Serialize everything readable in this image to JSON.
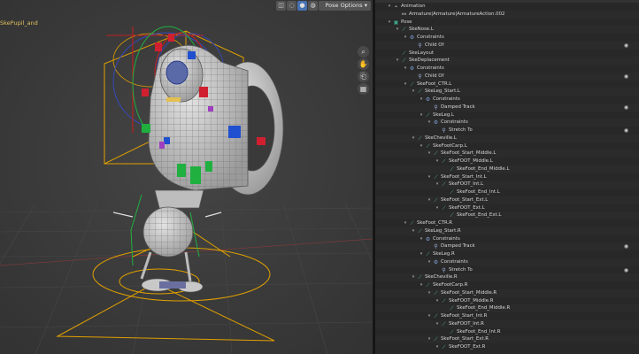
{
  "viewport": {
    "object_label": "SkePupil_and",
    "pose_options_label": "Pose Options",
    "pose_options_arrow": "▾",
    "header_buttons": [
      {
        "name": "xray-toggle",
        "glyph": "◫",
        "active": false
      },
      {
        "name": "shading-wireframe",
        "glyph": "◌",
        "active": false
      },
      {
        "name": "shading-solid",
        "glyph": "●",
        "active": true
      },
      {
        "name": "shading-material",
        "glyph": "◍",
        "active": false
      },
      {
        "name": "shading-rendered",
        "glyph": "◎",
        "active": false
      }
    ],
    "nav_buttons": [
      {
        "name": "zoom-icon",
        "glyph": "⌕"
      },
      {
        "name": "hand-pan-icon",
        "glyph": "✋"
      },
      {
        "name": "camera-view-icon",
        "glyph": "⎗"
      },
      {
        "name": "perspective-grid-icon",
        "glyph": "▦"
      }
    ]
  },
  "outliner": {
    "rows": [
      {
        "label": "Animation",
        "icon": "anim",
        "glyph": "⌁",
        "depth": 1,
        "arrow": "▾"
      },
      {
        "label": "Armature|Armature|ArmatureAction.002",
        "icon": "act",
        "glyph": "⚯",
        "depth": 2,
        "arrow": ""
      },
      {
        "label": "Pose",
        "icon": "pose",
        "glyph": "▣",
        "depth": 1,
        "arrow": "▾"
      },
      {
        "label": "SkeNose.L",
        "icon": "bone",
        "glyph": "⟋",
        "depth": 2,
        "arrow": "▾"
      },
      {
        "label": "Constraints",
        "icon": "constraints",
        "glyph": "⚙",
        "depth": 3,
        "arrow": "▾"
      },
      {
        "label": "Child Of",
        "icon": "cons",
        "glyph": "⚲",
        "depth": 4,
        "arrow": "",
        "eye": "◉"
      },
      {
        "label": "SkeLayout",
        "icon": "bone",
        "glyph": "⟋",
        "depth": 2,
        "arrow": ""
      },
      {
        "label": "SkeDeplacement",
        "icon": "bone",
        "glyph": "⟋",
        "depth": 2,
        "arrow": "▾"
      },
      {
        "label": "Constraints",
        "icon": "constraints",
        "glyph": "⚙",
        "depth": 3,
        "arrow": "▾"
      },
      {
        "label": "Child Of",
        "icon": "cons",
        "glyph": "⚲",
        "depth": 4,
        "arrow": "",
        "eye": "◉"
      },
      {
        "label": "SkeFoot_CTR.L",
        "icon": "bone",
        "glyph": "⟋",
        "depth": 3,
        "arrow": "▾"
      },
      {
        "label": "SkeLeg_Start.L",
        "icon": "bone",
        "glyph": "⟋",
        "depth": 4,
        "arrow": "▾"
      },
      {
        "label": "Constraints",
        "icon": "constraints",
        "glyph": "⚙",
        "depth": 5,
        "arrow": "▾"
      },
      {
        "label": "Damped Track",
        "icon": "cons",
        "glyph": "⚲",
        "depth": 6,
        "arrow": "",
        "eye": "◉"
      },
      {
        "label": "SkeLeg.L",
        "icon": "bone",
        "glyph": "⟋",
        "depth": 5,
        "arrow": "▾"
      },
      {
        "label": "Constraints",
        "icon": "constraints",
        "glyph": "⚙",
        "depth": 6,
        "arrow": "▾"
      },
      {
        "label": "Stretch To",
        "icon": "cons",
        "glyph": "⚲",
        "depth": 7,
        "arrow": "",
        "eye": "◉"
      },
      {
        "label": "SkeCheville.L",
        "icon": "bone",
        "glyph": "⟋",
        "depth": 4,
        "arrow": "▾"
      },
      {
        "label": "SkeFootCarp.L",
        "icon": "bone",
        "glyph": "⟋",
        "depth": 5,
        "arrow": "▾"
      },
      {
        "label": "SkeFoot_Start_Middle.L",
        "icon": "bone",
        "glyph": "⟋",
        "depth": 6,
        "arrow": "▾"
      },
      {
        "label": "SkeFOOT_Middle.L",
        "icon": "bone",
        "glyph": "⟋",
        "depth": 7,
        "arrow": "▾"
      },
      {
        "label": "SkeFoot_End_Middle.L",
        "icon": "bone",
        "glyph": "⟋",
        "depth": 8,
        "arrow": ""
      },
      {
        "label": "SkeFoot_Start_Int.L",
        "icon": "bone",
        "glyph": "⟋",
        "depth": 6,
        "arrow": "▾"
      },
      {
        "label": "SkeFOOT_Int.L",
        "icon": "bone",
        "glyph": "⟋",
        "depth": 7,
        "arrow": "▾"
      },
      {
        "label": "SkeFoot_End_Int.L",
        "icon": "bone",
        "glyph": "⟋",
        "depth": 8,
        "arrow": ""
      },
      {
        "label": "SkeFoot_Start_Ext.L",
        "icon": "bone",
        "glyph": "⟋",
        "depth": 6,
        "arrow": "▾"
      },
      {
        "label": "SkeFOOT_Ext.L",
        "icon": "bone",
        "glyph": "⟋",
        "depth": 7,
        "arrow": "▾"
      },
      {
        "label": "SkeFoot_End_Ext.L",
        "icon": "bone",
        "glyph": "⟋",
        "depth": 8,
        "arrow": ""
      },
      {
        "label": "SkeFoot_CTR.R",
        "icon": "bone",
        "glyph": "⟋",
        "depth": 3,
        "arrow": "▾"
      },
      {
        "label": "SkeLeg_Start.R",
        "icon": "bone",
        "glyph": "⟋",
        "depth": 4,
        "arrow": "▾"
      },
      {
        "label": "Constraints",
        "icon": "constraints",
        "glyph": "⚙",
        "depth": 5,
        "arrow": "▾"
      },
      {
        "label": "Damped Track",
        "icon": "cons",
        "glyph": "⚲",
        "depth": 6,
        "arrow": "",
        "eye": "◉"
      },
      {
        "label": "SkeLeg.R",
        "icon": "bone",
        "glyph": "⟋",
        "depth": 5,
        "arrow": "▾"
      },
      {
        "label": "Constraints",
        "icon": "constraints",
        "glyph": "⚙",
        "depth": 6,
        "arrow": "▾"
      },
      {
        "label": "Stretch To",
        "icon": "cons",
        "glyph": "⚲",
        "depth": 7,
        "arrow": "",
        "eye": "◉"
      },
      {
        "label": "SkeCheville.R",
        "icon": "bone",
        "glyph": "⟋",
        "depth": 4,
        "arrow": "▾"
      },
      {
        "label": "SkeFootCarp.R",
        "icon": "bone",
        "glyph": "⟋",
        "depth": 5,
        "arrow": "▾"
      },
      {
        "label": "SkeFoot_Start_Middle.R",
        "icon": "bone",
        "glyph": "⟋",
        "depth": 6,
        "arrow": "▾"
      },
      {
        "label": "SkeFOOT_Middle.R",
        "icon": "bone",
        "glyph": "⟋",
        "depth": 7,
        "arrow": "▾"
      },
      {
        "label": "SkeFoot_End_Middle.R",
        "icon": "bone",
        "glyph": "⟋",
        "depth": 8,
        "arrow": ""
      },
      {
        "label": "SkeFoot_Start_Int.R",
        "icon": "bone",
        "glyph": "⟋",
        "depth": 6,
        "arrow": "▾"
      },
      {
        "label": "SkeFOOT_Int.R",
        "icon": "bone",
        "glyph": "⟋",
        "depth": 7,
        "arrow": "▾"
      },
      {
        "label": "SkeFoot_End_Int.R",
        "icon": "bone",
        "glyph": "⟋",
        "depth": 8,
        "arrow": ""
      },
      {
        "label": "SkeFoot_Start_Ext.R",
        "icon": "bone",
        "glyph": "⟋",
        "depth": 6,
        "arrow": "▾"
      },
      {
        "label": "SkeFOOT_Ext.R",
        "icon": "bone",
        "glyph": "⟋",
        "depth": 7,
        "arrow": "▾"
      }
    ]
  }
}
